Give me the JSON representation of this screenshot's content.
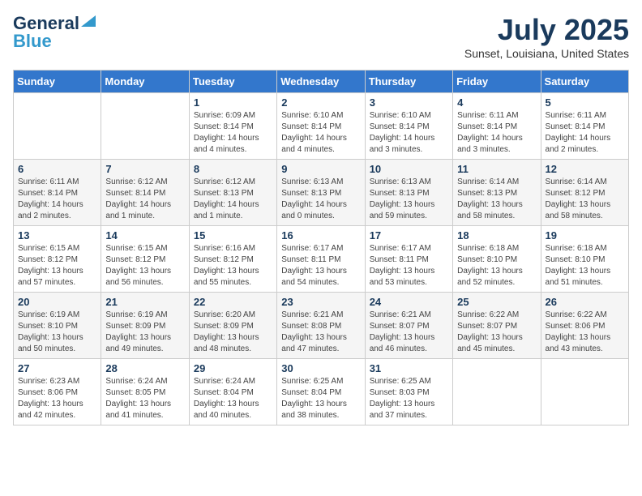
{
  "logo": {
    "line1": "General",
    "line2": "Blue"
  },
  "title": "July 2025",
  "location": "Sunset, Louisiana, United States",
  "weekdays": [
    "Sunday",
    "Monday",
    "Tuesday",
    "Wednesday",
    "Thursday",
    "Friday",
    "Saturday"
  ],
  "weeks": [
    [
      {
        "day": "",
        "info": ""
      },
      {
        "day": "",
        "info": ""
      },
      {
        "day": "1",
        "info": "Sunrise: 6:09 AM\nSunset: 8:14 PM\nDaylight: 14 hours\nand 4 minutes."
      },
      {
        "day": "2",
        "info": "Sunrise: 6:10 AM\nSunset: 8:14 PM\nDaylight: 14 hours\nand 4 minutes."
      },
      {
        "day": "3",
        "info": "Sunrise: 6:10 AM\nSunset: 8:14 PM\nDaylight: 14 hours\nand 3 minutes."
      },
      {
        "day": "4",
        "info": "Sunrise: 6:11 AM\nSunset: 8:14 PM\nDaylight: 14 hours\nand 3 minutes."
      },
      {
        "day": "5",
        "info": "Sunrise: 6:11 AM\nSunset: 8:14 PM\nDaylight: 14 hours\nand 2 minutes."
      }
    ],
    [
      {
        "day": "6",
        "info": "Sunrise: 6:11 AM\nSunset: 8:14 PM\nDaylight: 14 hours\nand 2 minutes."
      },
      {
        "day": "7",
        "info": "Sunrise: 6:12 AM\nSunset: 8:14 PM\nDaylight: 14 hours\nand 1 minute."
      },
      {
        "day": "8",
        "info": "Sunrise: 6:12 AM\nSunset: 8:13 PM\nDaylight: 14 hours\nand 1 minute."
      },
      {
        "day": "9",
        "info": "Sunrise: 6:13 AM\nSunset: 8:13 PM\nDaylight: 14 hours\nand 0 minutes."
      },
      {
        "day": "10",
        "info": "Sunrise: 6:13 AM\nSunset: 8:13 PM\nDaylight: 13 hours\nand 59 minutes."
      },
      {
        "day": "11",
        "info": "Sunrise: 6:14 AM\nSunset: 8:13 PM\nDaylight: 13 hours\nand 58 minutes."
      },
      {
        "day": "12",
        "info": "Sunrise: 6:14 AM\nSunset: 8:12 PM\nDaylight: 13 hours\nand 58 minutes."
      }
    ],
    [
      {
        "day": "13",
        "info": "Sunrise: 6:15 AM\nSunset: 8:12 PM\nDaylight: 13 hours\nand 57 minutes."
      },
      {
        "day": "14",
        "info": "Sunrise: 6:15 AM\nSunset: 8:12 PM\nDaylight: 13 hours\nand 56 minutes."
      },
      {
        "day": "15",
        "info": "Sunrise: 6:16 AM\nSunset: 8:12 PM\nDaylight: 13 hours\nand 55 minutes."
      },
      {
        "day": "16",
        "info": "Sunrise: 6:17 AM\nSunset: 8:11 PM\nDaylight: 13 hours\nand 54 minutes."
      },
      {
        "day": "17",
        "info": "Sunrise: 6:17 AM\nSunset: 8:11 PM\nDaylight: 13 hours\nand 53 minutes."
      },
      {
        "day": "18",
        "info": "Sunrise: 6:18 AM\nSunset: 8:10 PM\nDaylight: 13 hours\nand 52 minutes."
      },
      {
        "day": "19",
        "info": "Sunrise: 6:18 AM\nSunset: 8:10 PM\nDaylight: 13 hours\nand 51 minutes."
      }
    ],
    [
      {
        "day": "20",
        "info": "Sunrise: 6:19 AM\nSunset: 8:10 PM\nDaylight: 13 hours\nand 50 minutes."
      },
      {
        "day": "21",
        "info": "Sunrise: 6:19 AM\nSunset: 8:09 PM\nDaylight: 13 hours\nand 49 minutes."
      },
      {
        "day": "22",
        "info": "Sunrise: 6:20 AM\nSunset: 8:09 PM\nDaylight: 13 hours\nand 48 minutes."
      },
      {
        "day": "23",
        "info": "Sunrise: 6:21 AM\nSunset: 8:08 PM\nDaylight: 13 hours\nand 47 minutes."
      },
      {
        "day": "24",
        "info": "Sunrise: 6:21 AM\nSunset: 8:07 PM\nDaylight: 13 hours\nand 46 minutes."
      },
      {
        "day": "25",
        "info": "Sunrise: 6:22 AM\nSunset: 8:07 PM\nDaylight: 13 hours\nand 45 minutes."
      },
      {
        "day": "26",
        "info": "Sunrise: 6:22 AM\nSunset: 8:06 PM\nDaylight: 13 hours\nand 43 minutes."
      }
    ],
    [
      {
        "day": "27",
        "info": "Sunrise: 6:23 AM\nSunset: 8:06 PM\nDaylight: 13 hours\nand 42 minutes."
      },
      {
        "day": "28",
        "info": "Sunrise: 6:24 AM\nSunset: 8:05 PM\nDaylight: 13 hours\nand 41 minutes."
      },
      {
        "day": "29",
        "info": "Sunrise: 6:24 AM\nSunset: 8:04 PM\nDaylight: 13 hours\nand 40 minutes."
      },
      {
        "day": "30",
        "info": "Sunrise: 6:25 AM\nSunset: 8:04 PM\nDaylight: 13 hours\nand 38 minutes."
      },
      {
        "day": "31",
        "info": "Sunrise: 6:25 AM\nSunset: 8:03 PM\nDaylight: 13 hours\nand 37 minutes."
      },
      {
        "day": "",
        "info": ""
      },
      {
        "day": "",
        "info": ""
      }
    ]
  ]
}
